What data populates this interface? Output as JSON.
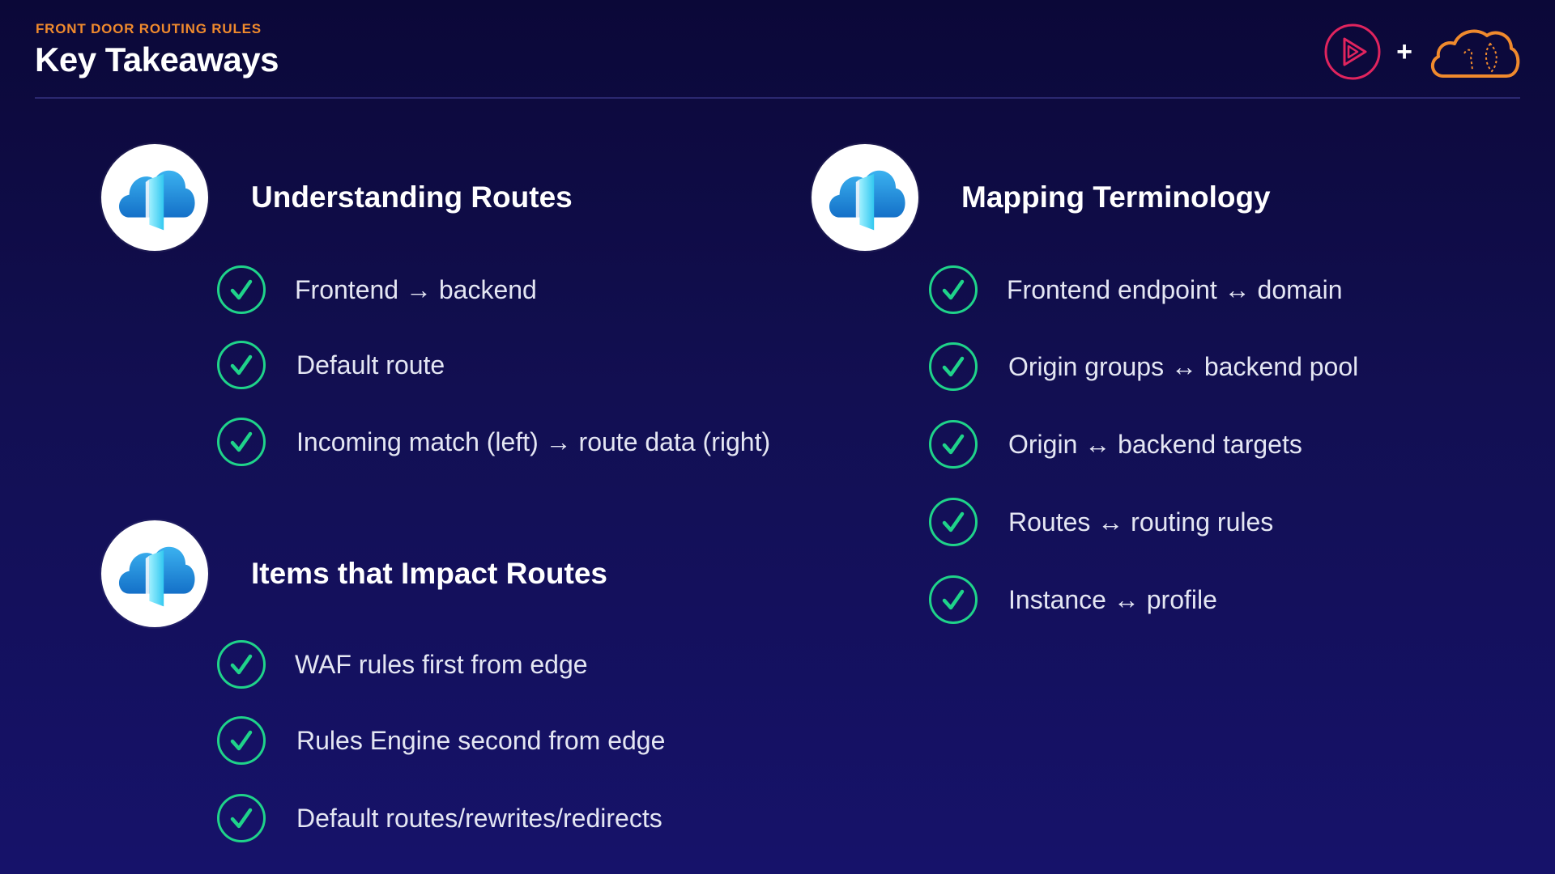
{
  "header": {
    "eyebrow": "FRONT DOOR ROUTING RULES",
    "title": "Key Takeaways",
    "plus": "+"
  },
  "colors": {
    "accent_orange": "#f08a2d",
    "check_green": "#1fd38a",
    "pluralsight_red": "#e0245e"
  },
  "sections": {
    "understanding": {
      "title": "Understanding Routes",
      "icon": "azure-front-door-icon",
      "items": [
        "Frontend → backend",
        "Default route",
        "Incoming match (left) → route data (right)"
      ]
    },
    "impact": {
      "title": "Items that Impact Routes",
      "icon": "azure-front-door-icon",
      "items": [
        "WAF rules first from edge",
        "Rules Engine second from edge",
        "Default routes/rewrites/redirects"
      ]
    },
    "mapping": {
      "title": "Mapping Terminology",
      "icon": "azure-front-door-icon",
      "items": [
        "Frontend endpoint ↔ domain",
        "Origin groups ↔ backend pool",
        "Origin ↔ backend targets",
        "Routes ↔ routing rules",
        "Instance ↔ profile"
      ]
    }
  }
}
